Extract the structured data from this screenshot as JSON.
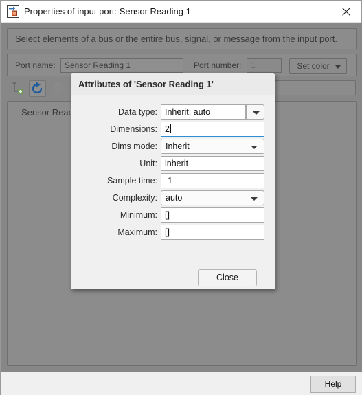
{
  "window": {
    "title": "Properties of input port: Sensor Reading 1",
    "icon": "simulink-input-port-icon",
    "close_icon": "close-icon",
    "instruction": "Select elements of a bus or the entire bus, signal, or message from the input port."
  },
  "port_row": {
    "port_name_label": "Port name:",
    "port_name_value": "Sensor Reading 1",
    "port_number_label": "Port number:",
    "port_number_value": "1",
    "set_color_label": "Set color",
    "set_color_icon": "chevron-down-icon"
  },
  "toolbar": {
    "buttons": [
      {
        "name": "add-element-button",
        "icon": "add-element-icon"
      },
      {
        "name": "refresh-button",
        "icon": "refresh-icon"
      },
      {
        "name": "delete-button",
        "icon": "trash-icon"
      }
    ],
    "search_placeholder": "..."
  },
  "tree": {
    "items": [
      {
        "label": "Sensor Reading 1"
      }
    ]
  },
  "footer": {
    "help_label": "Help"
  },
  "modal": {
    "title": "Attributes of 'Sensor Reading 1'",
    "close_label": "Close",
    "fields": [
      {
        "label": "Data type:",
        "value": "Inherit: auto",
        "type": "combo-split",
        "focused": false
      },
      {
        "label": "Dimensions:",
        "value": "2",
        "type": "text",
        "focused": true
      },
      {
        "label": "Dims mode:",
        "value": "Inherit",
        "type": "combo",
        "focused": false
      },
      {
        "label": "Unit:",
        "value": "inherit",
        "type": "text",
        "focused": false
      },
      {
        "label": "Sample time:",
        "value": "-1",
        "type": "text",
        "focused": false
      },
      {
        "label": "Complexity:",
        "value": "auto",
        "type": "combo",
        "focused": false
      },
      {
        "label": "Minimum:",
        "value": "[]",
        "type": "text",
        "focused": false
      },
      {
        "label": "Maximum:",
        "value": "[]",
        "type": "text",
        "focused": false
      }
    ]
  },
  "colors": {
    "focus_border": "#2c8fd6",
    "overlay_dim": "#878787",
    "modal_bg": "#f0f0f0",
    "titlebar_bg": "#ffffff"
  }
}
